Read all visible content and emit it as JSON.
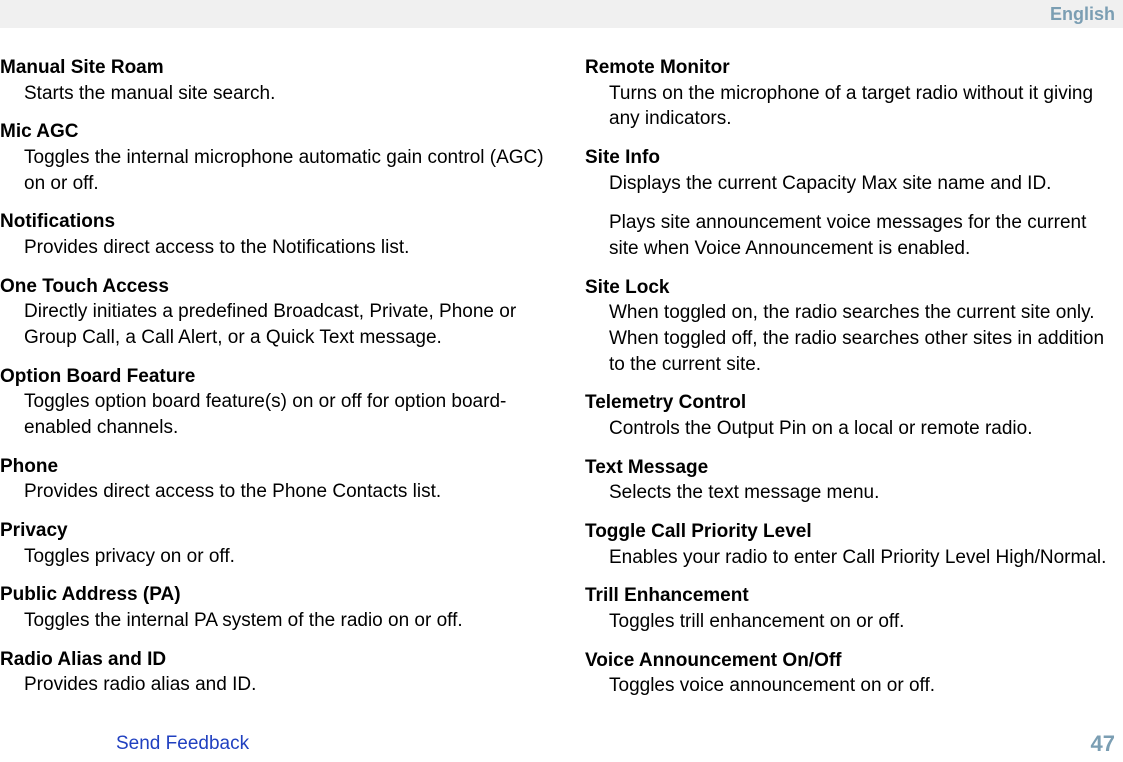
{
  "header": {
    "language": "English"
  },
  "left": {
    "items": [
      {
        "title": "Manual Site Roam",
        "desc": [
          "Starts the manual site search."
        ]
      },
      {
        "title": "Mic AGC",
        "desc": [
          "Toggles the internal microphone automatic gain control (AGC) on or off."
        ]
      },
      {
        "title": "Notifications",
        "desc": [
          "Provides direct access to the Notifications list."
        ]
      },
      {
        "title": "One Touch Access",
        "desc": [
          "Directly initiates a predefined Broadcast, Private, Phone or Group Call, a Call Alert, or a Quick Text message."
        ]
      },
      {
        "title": "Option Board Feature",
        "desc": [
          "Toggles option board feature(s) on or off for option board-enabled channels."
        ]
      },
      {
        "title": "Phone",
        "desc": [
          "Provides direct access to the Phone Contacts list."
        ]
      },
      {
        "title": "Privacy",
        "desc": [
          "Toggles privacy on or off."
        ]
      },
      {
        "title": "Public Address (PA)",
        "desc": [
          "Toggles the internal PA system of the radio on or off."
        ]
      },
      {
        "title": "Radio Alias and ID",
        "desc": [
          "Provides radio alias and ID."
        ]
      }
    ]
  },
  "right": {
    "items": [
      {
        "title": "Remote Monitor",
        "desc": [
          "Turns on the microphone of a target radio without it giving any indicators."
        ]
      },
      {
        "title": "Site Info",
        "desc": [
          "Displays the current Capacity Max site name and ID.",
          "Plays site announcement voice messages for the current site when Voice Announcement is enabled."
        ]
      },
      {
        "title": "Site Lock",
        "desc": [
          "When toggled on, the radio searches the current site only. When toggled off, the radio searches other sites in addition to the current site."
        ]
      },
      {
        "title": "Telemetry Control",
        "desc": [
          "Controls the Output Pin on a local or remote radio."
        ]
      },
      {
        "title": "Text Message",
        "desc": [
          "Selects the text message menu."
        ]
      },
      {
        "title": "Toggle Call Priority Level",
        "desc": [
          "Enables your radio to enter Call Priority Level High/Normal."
        ]
      },
      {
        "title": "Trill Enhancement",
        "desc": [
          "Toggles trill enhancement on or off."
        ]
      },
      {
        "title": "Voice Announcement On/Off",
        "desc": [
          "Toggles voice announcement on or off."
        ]
      }
    ]
  },
  "footer": {
    "feedback": "Send Feedback",
    "page": "47"
  }
}
